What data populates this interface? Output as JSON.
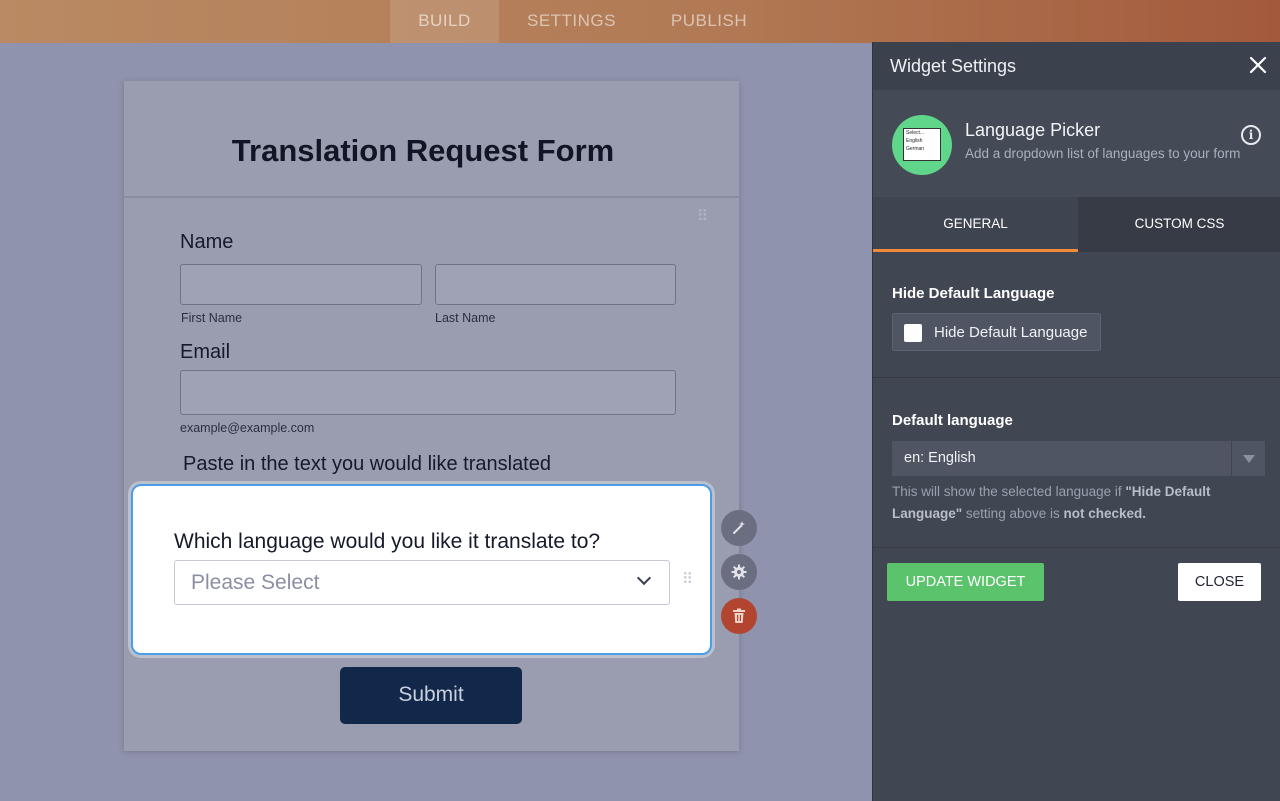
{
  "topbar": {
    "tabs": [
      {
        "label": "BUILD",
        "active": true
      },
      {
        "label": "SETTINGS",
        "active": false
      },
      {
        "label": "PUBLISH",
        "active": false
      }
    ]
  },
  "form": {
    "title": "Translation Request Form",
    "name_label": "Name",
    "first_name_sublabel": "First Name",
    "last_name_sublabel": "Last Name",
    "email_label": "Email",
    "email_sublabel": "example@example.com",
    "paste_label": "Paste in the text you would like translated",
    "widget": {
      "question": "Which language would you like it translate to?",
      "placeholder": "Please Select"
    },
    "submit_label": "Submit"
  },
  "panel": {
    "title": "Widget Settings",
    "widget_name": "Language Picker",
    "widget_description": "Add a dropdown list of languages to your form",
    "widget_icon_lines": [
      "Select...",
      "English",
      "German"
    ],
    "tabs": [
      {
        "label": "GENERAL",
        "active": true
      },
      {
        "label": "CUSTOM CSS",
        "active": false
      }
    ],
    "hide_default": {
      "title": "Hide Default Language",
      "toggle_label": "Hide Default Language",
      "checked": false
    },
    "default_language": {
      "title": "Default language",
      "value": "en: English",
      "help_prefix": "This will show the selected language if ",
      "help_bold_1": "\"Hide Default Language\"",
      "help_mid": " setting above is ",
      "help_bold_2": "not checked."
    },
    "update_label": "UPDATE WIDGET",
    "close_label": "CLOSE"
  },
  "colors": {
    "accent_tab": "#f08b3a",
    "update_button": "#5ac36b",
    "submit_button": "#12284a",
    "delete_button": "#b2452f",
    "widget_border": "#4a9ee8"
  }
}
